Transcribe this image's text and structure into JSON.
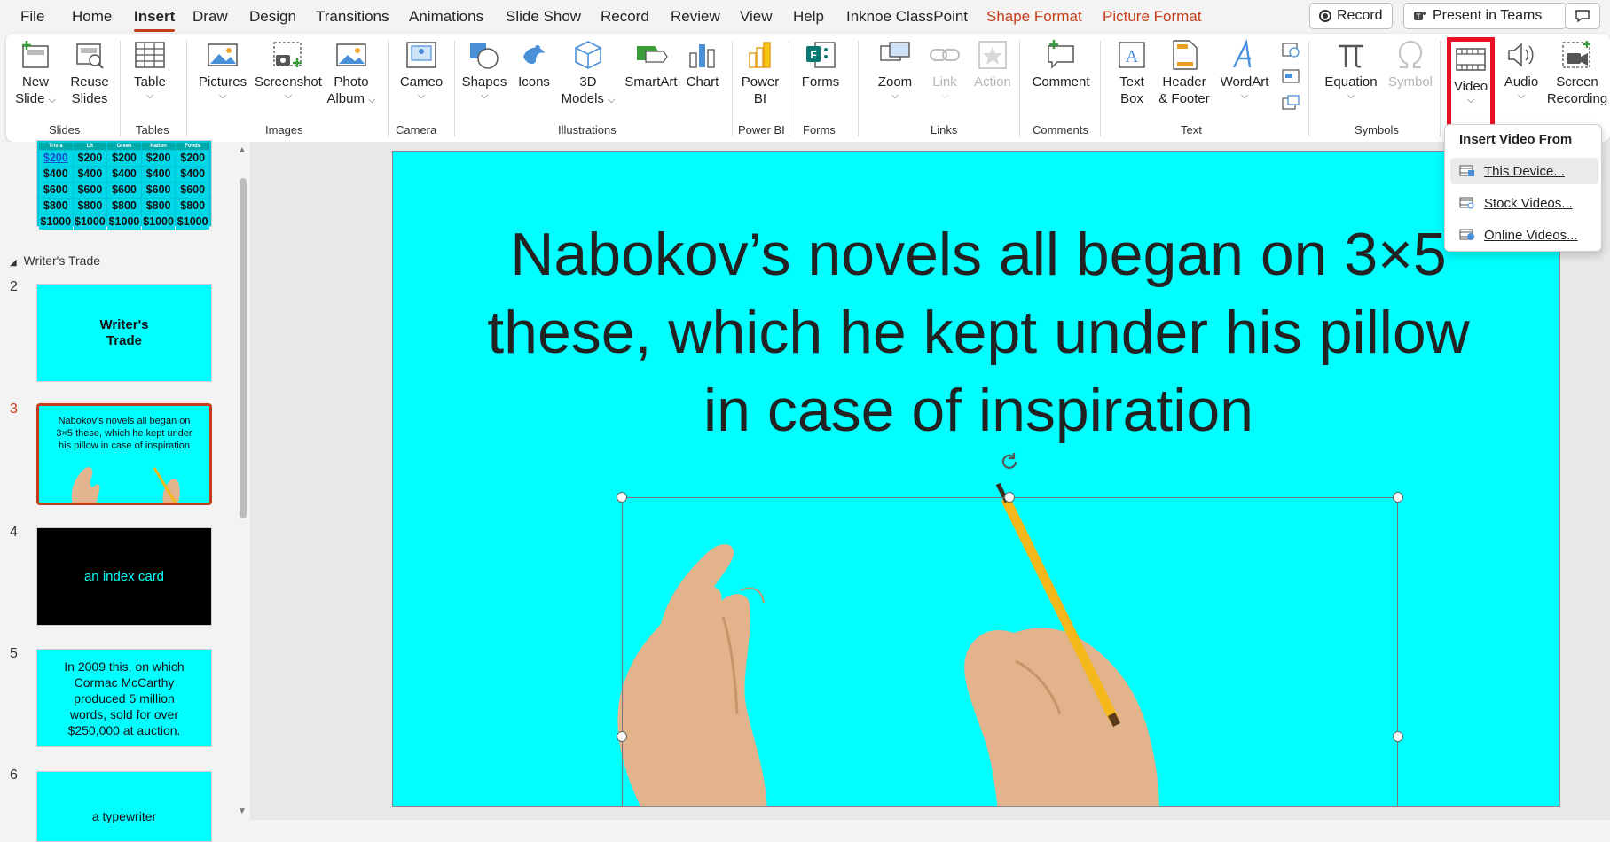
{
  "menu": {
    "tabs": [
      "File",
      "Home",
      "Insert",
      "Draw",
      "Design",
      "Transitions",
      "Animations",
      "Slide Show",
      "Record",
      "Review",
      "View",
      "Help",
      "Inknoe ClassPoint",
      "Shape Format",
      "Picture Format"
    ],
    "active_tab": "Insert",
    "record_label": "Record",
    "present_label": "Present in Teams"
  },
  "ribbon": {
    "new_slide": [
      "New",
      "Slide"
    ],
    "reuse_slides": [
      "Reuse",
      "Slides"
    ],
    "table": "Table",
    "pictures": "Pictures",
    "screenshot": "Screenshot",
    "photo_album": [
      "Photo",
      "Album"
    ],
    "cameo": "Cameo",
    "shapes": "Shapes",
    "icons": "Icons",
    "models": [
      "3D",
      "Models"
    ],
    "smartart": "SmartArt",
    "chart": "Chart",
    "powerbi": [
      "Power",
      "BI"
    ],
    "forms": "Forms",
    "zoom": "Zoom",
    "link": "Link",
    "action": "Action",
    "comment": "Comment",
    "textbox": [
      "Text",
      "Box"
    ],
    "header_footer": [
      "Header",
      "& Footer"
    ],
    "wordart": "WordArt",
    "equation": "Equation",
    "symbol": "Symbol",
    "video": "Video",
    "audio": "Audio",
    "screen_recording": [
      "Screen",
      "Recording"
    ],
    "groups": [
      "Slides",
      "Tables",
      "Images",
      "Camera",
      "Illustrations",
      "Power BI",
      "Forms",
      "Links",
      "Comments",
      "Text",
      "Symbols"
    ]
  },
  "video_menu": {
    "header": "Insert Video From",
    "items": [
      "This Device...",
      "Stock Videos...",
      "Online Videos..."
    ]
  },
  "slides_pane": {
    "table_header": [
      "Trivia",
      "Lit",
      "Greek",
      "Nation",
      "Foods"
    ],
    "table_rows": [
      [
        "$200",
        "$200",
        "$200",
        "$200",
        "$200"
      ],
      [
        "$400",
        "$400",
        "$400",
        "$400",
        "$400"
      ],
      [
        "$600",
        "$600",
        "$600",
        "$600",
        "$600"
      ],
      [
        "$800",
        "$800",
        "$800",
        "$800",
        "$800"
      ],
      [
        "$1000",
        "$1000",
        "$1000",
        "$1000",
        "$1000"
      ]
    ],
    "section": "Writer's Trade",
    "slides": [
      {
        "num": "2",
        "text": "Writer's\nTrade"
      },
      {
        "num": "3",
        "text": "Nabokov's novels all began on 3×5 these, which he kept under his pillow in case of inspiration"
      },
      {
        "num": "4",
        "text": "an index card"
      },
      {
        "num": "5",
        "text": "In 2009 this, on which Cormac McCarthy produced 5 million words, sold for over $250,000 at auction."
      },
      {
        "num": "6",
        "text": "a typewriter"
      }
    ]
  },
  "slide": {
    "title": "Nabokov’s novels all began on 3×5 these, which he kept under his pillow in case of inspiration"
  },
  "colors": {
    "accent": "#c43e1c",
    "slide_bg": "#00ffff",
    "highlight": "#e81123",
    "dark_slide": "#000000"
  }
}
